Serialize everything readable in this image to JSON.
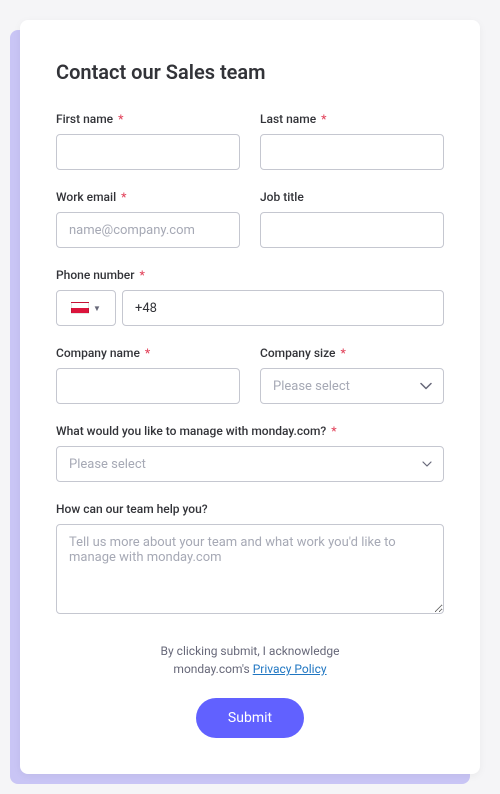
{
  "title": "Contact our Sales team",
  "fields": {
    "firstName": {
      "label": "First name"
    },
    "lastName": {
      "label": "Last name"
    },
    "workEmail": {
      "label": "Work email",
      "placeholder": "name@company.com"
    },
    "jobTitle": {
      "label": "Job title"
    },
    "phone": {
      "label": "Phone number",
      "dialCode": "+48"
    },
    "companyName": {
      "label": "Company name"
    },
    "companySize": {
      "label": "Company size",
      "placeholder": "Please select"
    },
    "manage": {
      "label": "What would you like to manage with monday.com?",
      "placeholder": "Please select"
    },
    "help": {
      "label": "How can our team help you?",
      "placeholder": "Tell us more about your team and what work you'd like to manage with monday.com"
    }
  },
  "requiredMark": "*",
  "disclaimer": {
    "line1": "By clicking submit, I acknowledge",
    "line2_prefix": "monday.com's ",
    "privacyPolicy": "Privacy Policy"
  },
  "submitLabel": "Submit"
}
